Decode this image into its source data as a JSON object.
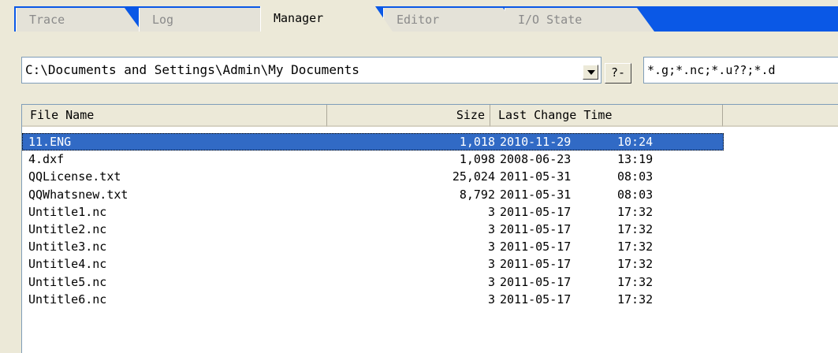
{
  "tabs": [
    {
      "label": "Trace"
    },
    {
      "label": "Log"
    },
    {
      "label": "Manager"
    },
    {
      "label": "Editor"
    },
    {
      "label": "I/O State"
    }
  ],
  "active_tab": "Manager",
  "path": {
    "value": "C:\\Documents and Settings\\Admin\\My Documents",
    "help_label": "?-"
  },
  "filter": {
    "value": "*.g;*.nc;*.u??;*.d"
  },
  "list": {
    "columns": {
      "name": "File Name",
      "size": "Size",
      "time": "Last Change Time"
    },
    "rows": [
      {
        "name": "11.ENG",
        "size": "1,018",
        "date": "2010-11-29",
        "time": "10:24",
        "selected": true
      },
      {
        "name": "4.dxf",
        "size": "1,098",
        "date": "2008-06-23",
        "time": "13:19"
      },
      {
        "name": "QQLicense.txt",
        "size": "25,024",
        "date": "2011-05-31",
        "time": "08:03"
      },
      {
        "name": "QQWhatsnew.txt",
        "size": "8,792",
        "date": "2011-05-31",
        "time": "08:03"
      },
      {
        "name": "Untitle1.nc",
        "size": "3",
        "date": "2011-05-17",
        "time": "17:32"
      },
      {
        "name": "Untitle2.nc",
        "size": "3",
        "date": "2011-05-17",
        "time": "17:32"
      },
      {
        "name": "Untitle3.nc",
        "size": "3",
        "date": "2011-05-17",
        "time": "17:32"
      },
      {
        "name": "Untitle4.nc",
        "size": "3",
        "date": "2011-05-17",
        "time": "17:32"
      },
      {
        "name": "Untitle5.nc",
        "size": "3",
        "date": "2011-05-17",
        "time": "17:32"
      },
      {
        "name": "Untitle6.nc",
        "size": "3",
        "date": "2011-05-17",
        "time": "17:32"
      }
    ]
  },
  "colors": {
    "tab_strip": "#0a58e6",
    "selection": "#316ac5",
    "window_bg": "#ece9d8"
  }
}
